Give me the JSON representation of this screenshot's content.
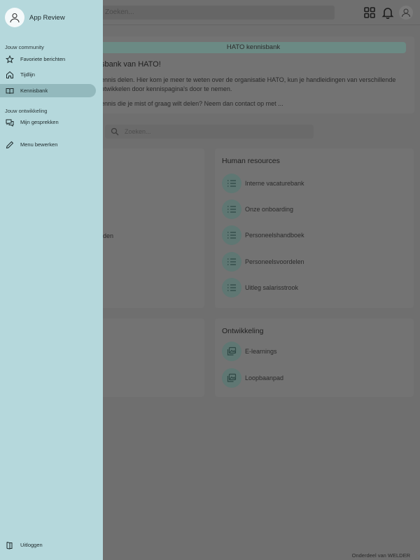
{
  "topbar": {
    "search_placeholder": "Zoeken..."
  },
  "intro": {
    "banner": "HATO kennisbank",
    "title": "sbank van HATO!",
    "text": "ennis delen. Hier kom je meer te weten over de organisatie HATO, kun je handleidingen van verschillende ntwikkelen door kennispagina's door te nemen.",
    "text2": "ennis die je mist of graag wilt delen? Neem dan contact op met ..."
  },
  "kb_search": {
    "placeholder": "Zoeken..."
  },
  "left_card": {
    "ghost_label": "rden"
  },
  "human_resources": {
    "title": "Human resources",
    "items": [
      {
        "label": "Interne vacaturebank"
      },
      {
        "label": "Onze onboarding"
      },
      {
        "label": "Personeelshandboek"
      },
      {
        "label": "Personeelsvoordelen"
      },
      {
        "label": "Uitleg salarisstrook"
      }
    ]
  },
  "ontwikkeling": {
    "title": "Ontwikkeling",
    "items": [
      {
        "label": "E-learnings"
      },
      {
        "label": "Loopbaanpad"
      }
    ]
  },
  "footer": {
    "credit": "Onderdeel van WELDER"
  },
  "drawer": {
    "app_name": "App Review",
    "section_community": "Jouw community",
    "section_development": "Jouw ontwikkeling",
    "items": {
      "favorites": "Favoriete berichten",
      "timeline": "Tijdlijn",
      "knowledge_base": "Kennisbank",
      "conversations": "Mijn gesprekken",
      "edit_menu": "Menu bewerken",
      "logout": "Uitloggen"
    }
  },
  "colors": {
    "drawer_bg": "#b5d8dc",
    "drawer_active": "#93b9bd",
    "overlay": "#6f6f6f",
    "accent": "#5f7773"
  }
}
